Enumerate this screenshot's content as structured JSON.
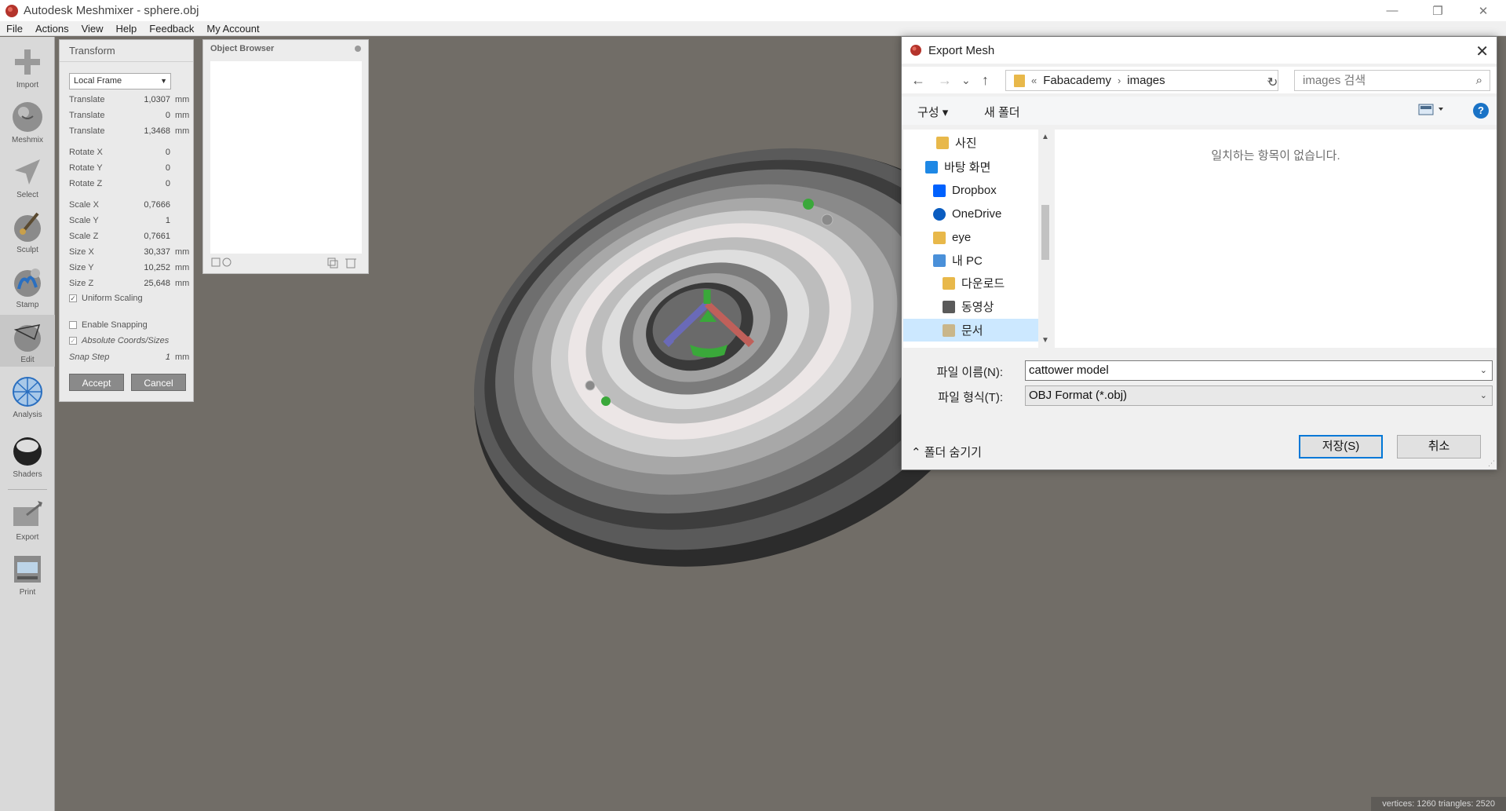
{
  "window": {
    "title": "Autodesk Meshmixer - sphere.obj",
    "minimize": "—",
    "restore": "❐",
    "close": "✕"
  },
  "menu": [
    "File",
    "Actions",
    "View",
    "Help",
    "Feedback",
    "My Account"
  ],
  "tools": [
    {
      "name": "import",
      "label": "Import",
      "icon": "plus-icon"
    },
    {
      "name": "meshmix",
      "label": "Meshmix",
      "icon": "bunny-sphere-icon"
    },
    {
      "name": "select",
      "label": "Select",
      "icon": "arrow-pointer-icon"
    },
    {
      "name": "sculpt",
      "label": "Sculpt",
      "icon": "brush-sphere-icon"
    },
    {
      "name": "stamp",
      "label": "Stamp",
      "icon": "stamp-sphere-icon"
    },
    {
      "name": "edit",
      "label": "Edit",
      "icon": "edit-sphere-icon"
    },
    {
      "name": "analysis",
      "label": "Analysis",
      "icon": "mesh-sphere-icon"
    },
    {
      "name": "shaders",
      "label": "Shaders",
      "icon": "shaded-sphere-icon"
    },
    {
      "name": "export",
      "label": "Export",
      "icon": "export-folder-icon"
    },
    {
      "name": "print",
      "label": "Print",
      "icon": "printer-icon"
    }
  ],
  "transform": {
    "title": "Transform",
    "frame": "Local Frame",
    "rows": [
      {
        "label": "Translate",
        "value": "1,0307",
        "unit": "mm"
      },
      {
        "label": "Translate",
        "value": "0",
        "unit": "mm"
      },
      {
        "label": "Translate",
        "value": "1,3468",
        "unit": "mm"
      },
      {
        "label": "Rotate X",
        "value": "0",
        "unit": ""
      },
      {
        "label": "Rotate Y",
        "value": "0",
        "unit": ""
      },
      {
        "label": "Rotate Z",
        "value": "0",
        "unit": ""
      },
      {
        "label": "Scale X",
        "value": "0,7666",
        "unit": ""
      },
      {
        "label": "Scale Y",
        "value": "1",
        "unit": ""
      },
      {
        "label": "Scale Z",
        "value": "0,7661",
        "unit": ""
      },
      {
        "label": "Size X",
        "value": "30,337",
        "unit": "mm"
      },
      {
        "label": "Size Y",
        "value": "10,252",
        "unit": "mm"
      },
      {
        "label": "Size Z",
        "value": "25,648",
        "unit": "mm"
      }
    ],
    "uniform_scaling": "Uniform Scaling",
    "enable_snapping": "Enable Snapping",
    "absolute_coords": "Absolute Coords/Sizes",
    "snap_step_label": "Snap Step",
    "snap_step_value": "1",
    "snap_step_unit": "mm",
    "accept": "Accept",
    "cancel": "Cancel"
  },
  "object_browser": {
    "title": "Object Browser"
  },
  "status": "vertices: 1260 triangles: 2520",
  "dialog": {
    "title": "Export Mesh",
    "close": "✕",
    "back": "←",
    "forward": "→",
    "recent": "⌄",
    "up": "↑",
    "path": [
      "Fabacademy",
      "images"
    ],
    "path_prefix": "«",
    "path_sep": "›",
    "search_placeholder": "images 검색",
    "organize": "구성 ▾",
    "new_folder": "새 폴더",
    "help": "?",
    "nav_items": [
      {
        "label": "사진",
        "icon": "photos-folder-icon",
        "color": "#e8b84a"
      },
      {
        "label": "바탕 화면",
        "icon": "desktop-icon",
        "color": "#1e88e5"
      },
      {
        "label": "Dropbox",
        "icon": "dropbox-icon",
        "color": "#0061fe"
      },
      {
        "label": "OneDrive",
        "icon": "onedrive-icon",
        "color": "#0a5cc0"
      },
      {
        "label": "eye",
        "icon": "user-folder-icon",
        "color": "#e8b84a"
      },
      {
        "label": "내 PC",
        "icon": "this-pc-icon",
        "color": "#4a90d9"
      },
      {
        "label": "다운로드",
        "icon": "downloads-folder-icon",
        "color": "#e8b84a"
      },
      {
        "label": "동영상",
        "icon": "videos-folder-icon",
        "color": "#5a5a5a"
      },
      {
        "label": "문서",
        "icon": "documents-folder-icon",
        "color": "#c9b68a"
      }
    ],
    "empty_text": "일치하는 항목이 없습니다.",
    "filename_label": "파일 이름(N):",
    "filename_value": "cattower model",
    "filetype_label": "파일 형식(T):",
    "filetype_value": "OBJ Format (*.obj)",
    "hide_folders": "폴더 숨기기",
    "save": "저장(S)",
    "cancel": "취소"
  }
}
